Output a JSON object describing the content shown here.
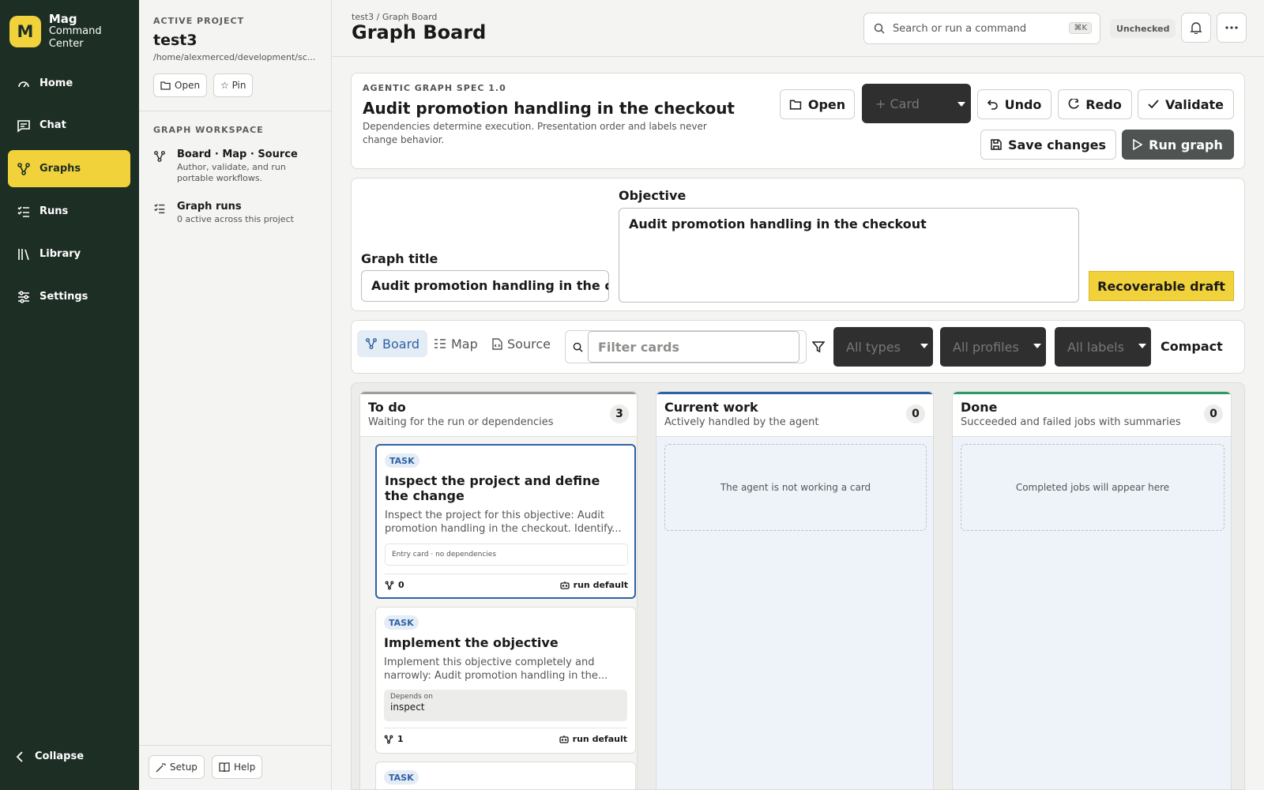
{
  "brand": {
    "logo_letter": "M",
    "name": "Mag",
    "subtitle": "Command Center"
  },
  "nav": {
    "items": [
      {
        "label": "Home",
        "icon": "gauge-icon"
      },
      {
        "label": "Chat",
        "icon": "chat-icon"
      },
      {
        "label": "Graphs",
        "icon": "graph-icon",
        "active": true
      },
      {
        "label": "Runs",
        "icon": "list-icon"
      },
      {
        "label": "Library",
        "icon": "library-icon"
      },
      {
        "label": "Settings",
        "icon": "sliders-icon"
      }
    ],
    "collapse_label": "Collapse"
  },
  "project": {
    "section_label": "ACTIVE PROJECT",
    "name": "test3",
    "path": "/home/alexmerced/development/sc...",
    "open_label": "Open",
    "pin_label": "☆ Pin",
    "workspace_label": "GRAPH WORKSPACE",
    "workspace_items": [
      {
        "title": "Board · Map · Source",
        "subtitle": "Author, validate, and run portable workflows."
      },
      {
        "title": "Graph runs",
        "subtitle": "0 active across this project"
      }
    ],
    "setup_label": "Setup",
    "help_label": "Help"
  },
  "topbar": {
    "breadcrumb": "test3  /  Graph Board",
    "title": "Graph Board",
    "search_placeholder": "Search or run a command",
    "search_shortcut": "⌘K",
    "status": "Unchecked"
  },
  "spec": {
    "label": "AGENTIC GRAPH SPEC 1.0",
    "title": "Audit promotion handling in the checkout",
    "description": "Dependencies determine execution. Presentation order and labels never change behavior.",
    "buttons": {
      "open": "Open",
      "card": "+ Card",
      "undo": "Undo",
      "redo": "Redo",
      "validate": "Validate",
      "save": "Save changes",
      "run": "Run graph"
    }
  },
  "form": {
    "graph_title_label": "Graph title",
    "graph_title_value": "Audit promotion handling in the checkout",
    "objective_label": "Objective",
    "objective_value": "Audit promotion handling in the checkout",
    "draft_badge": "Recoverable draft"
  },
  "toolbar": {
    "tabs": [
      {
        "label": "Board",
        "active": true
      },
      {
        "label": "Map"
      },
      {
        "label": "Source"
      }
    ],
    "filter_placeholder": "Filter cards",
    "selects": [
      "All types",
      "All profiles",
      "All labels"
    ],
    "compact_label": "Compact"
  },
  "board": {
    "columns": [
      {
        "title": "To do",
        "subtitle": "Waiting for the run or dependencies",
        "count": "3",
        "accent": "#9aa09c"
      },
      {
        "title": "Current work",
        "subtitle": "Actively handled by the agent",
        "count": "0",
        "accent": "#2f62a5",
        "empty": "The agent is not working a card"
      },
      {
        "title": "Done",
        "subtitle": "Succeeded and failed jobs with summaries",
        "count": "0",
        "accent": "#2e9a63",
        "empty": "Completed jobs will appear here"
      }
    ],
    "cards": [
      {
        "badge": "TASK",
        "title": "Inspect the project and define the change",
        "description": "Inspect the project for this objective: Audit promotion handling in the checkout. Identify...",
        "deps_text": "Entry card · no dependencies",
        "count": "0",
        "profile": "run default"
      },
      {
        "badge": "TASK",
        "title": "Implement the objective",
        "description": "Implement this objective completely and narrowly: Audit promotion handling in the...",
        "deps_label": "Depends on",
        "deps_value": "inspect",
        "count": "1",
        "profile": "run default"
      },
      {
        "badge": "TASK"
      }
    ]
  },
  "colors": {
    "nav_bg": "#1d2e25",
    "accent_yellow": "#f2d23a",
    "link_blue": "#2f62a5"
  }
}
